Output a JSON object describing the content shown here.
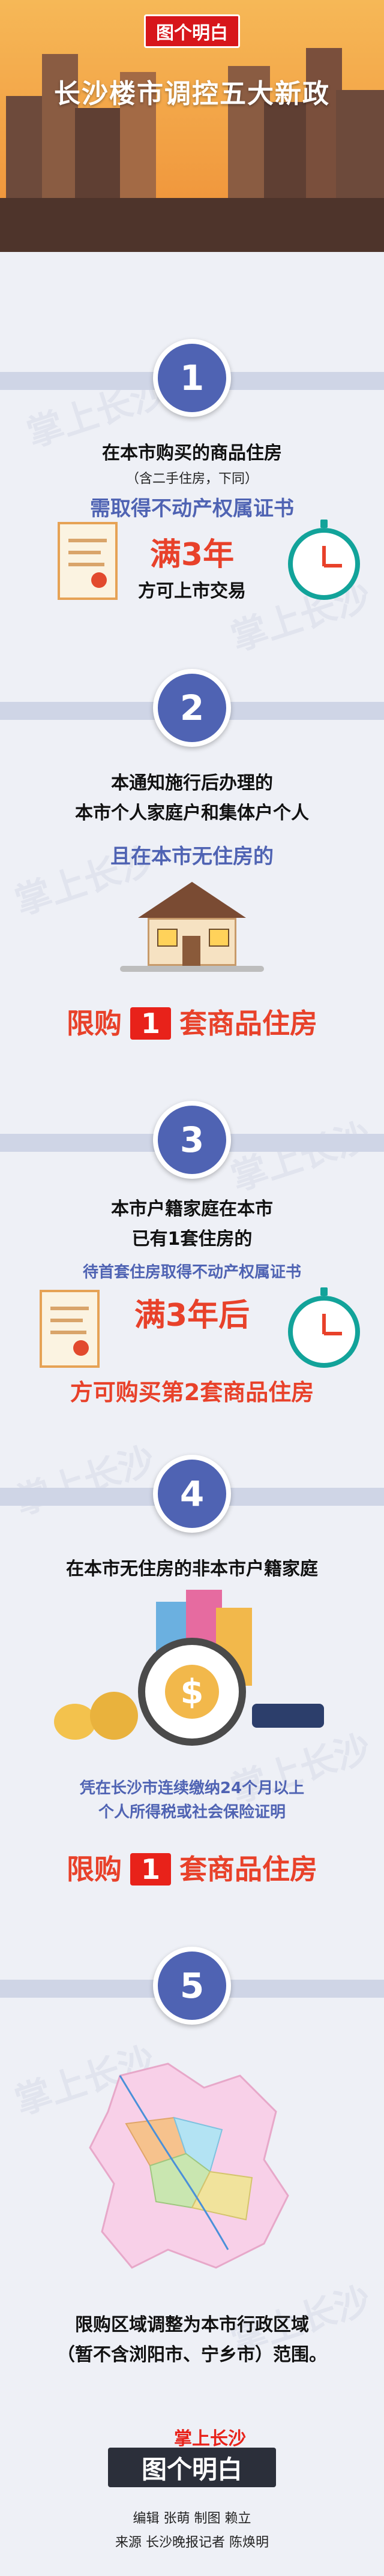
{
  "header": {
    "logo_text": "图个明白",
    "title": "长沙楼市调控五大新政"
  },
  "watermark": "掌上长沙",
  "sections": [
    {
      "number": "1",
      "line1": "在本市购买的商品住房",
      "note": "（含二手住房，下同）",
      "line2": "需取得不动产权属证书",
      "emphasis": "满3年",
      "line3": "方可上市交易"
    },
    {
      "number": "2",
      "line1": "本通知施行后办理的",
      "line2": "本市个人家庭户和集体户个人",
      "line3": "且在本市无住房的",
      "limit_prefix": "限购",
      "limit_count": "1",
      "limit_suffix": "套商品住房"
    },
    {
      "number": "3",
      "line1": "本市户籍家庭在本市",
      "line2": "已有1套住房的",
      "line3": "待首套住房取得不动产权属证书",
      "emphasis": "满3年后",
      "line4": "方可购买第2套商品住房"
    },
    {
      "number": "4",
      "line1": "在本市无住房的非本市户籍家庭",
      "line2": "凭在长沙市连续缴纳24个月以上",
      "line3": "个人所得税或社会保险证明",
      "limit_prefix": "限购",
      "limit_count": "1",
      "limit_suffix": "套商品住房"
    },
    {
      "number": "5",
      "line1": "限购区域调整为本市行政区域",
      "line2": "（暂不含浏阳市、宁乡市）范围。"
    }
  ],
  "footer": {
    "brand_top": "掌上长沙",
    "brand_main": "图个明白",
    "credits1": "编辑 张萌  制图 赖立",
    "credits2": "来源  长沙晚报记者 陈焕明"
  },
  "colors": {
    "accent_blue": "#4f63b3",
    "accent_red": "#e8412a",
    "header_orange": "#f2a541"
  }
}
